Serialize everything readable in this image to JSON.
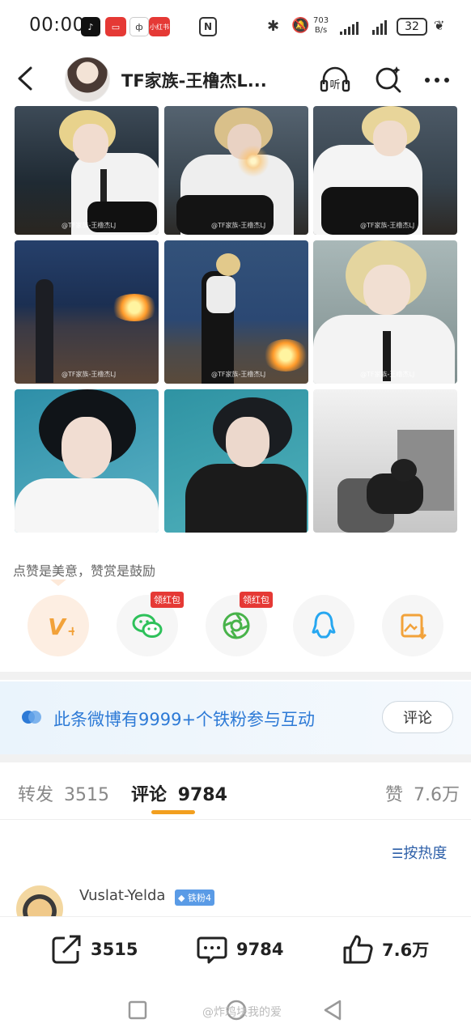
{
  "status": {
    "time": "00:00",
    "net_speed_top": "703",
    "net_speed_bottom": "B/s",
    "battery": "32",
    "app_icons": [
      "tiktok-icon",
      "weibo-icon",
      "app-icon",
      "xiaohongshu-icon"
    ],
    "xhs_label": "小红书"
  },
  "header": {
    "title": "TF家族-王橹杰L...",
    "listen_label": "听"
  },
  "photos": {
    "watermark": "@TF家族-王橹杰LJ"
  },
  "like_hint": "点赞是美意，赞赏是鼓励",
  "rewards": [
    {
      "icon": "v-plus-icon",
      "tag": ""
    },
    {
      "icon": "wechat-icon",
      "tag": "领红包"
    },
    {
      "icon": "moments-icon",
      "tag": "领红包"
    },
    {
      "icon": "qq-icon",
      "tag": ""
    },
    {
      "icon": "save-image-icon",
      "tag": ""
    }
  ],
  "fans_bar": {
    "text": "此条微博有9999+个铁粉参与互动",
    "button": "评论"
  },
  "tabs": {
    "repost_label": "转发",
    "repost_count": "3515",
    "comment_label": "评论",
    "comment_count": "9784",
    "like_label": "赞",
    "like_count": "7.6万"
  },
  "sort_label": "按热度",
  "comment": {
    "username": "Vuslat-Yelda",
    "badge": "铁粉4"
  },
  "actions": {
    "repost": "3515",
    "comment": "9784",
    "like": "7.6万"
  },
  "watermark_bottom": "@炸鸡块我的爱"
}
